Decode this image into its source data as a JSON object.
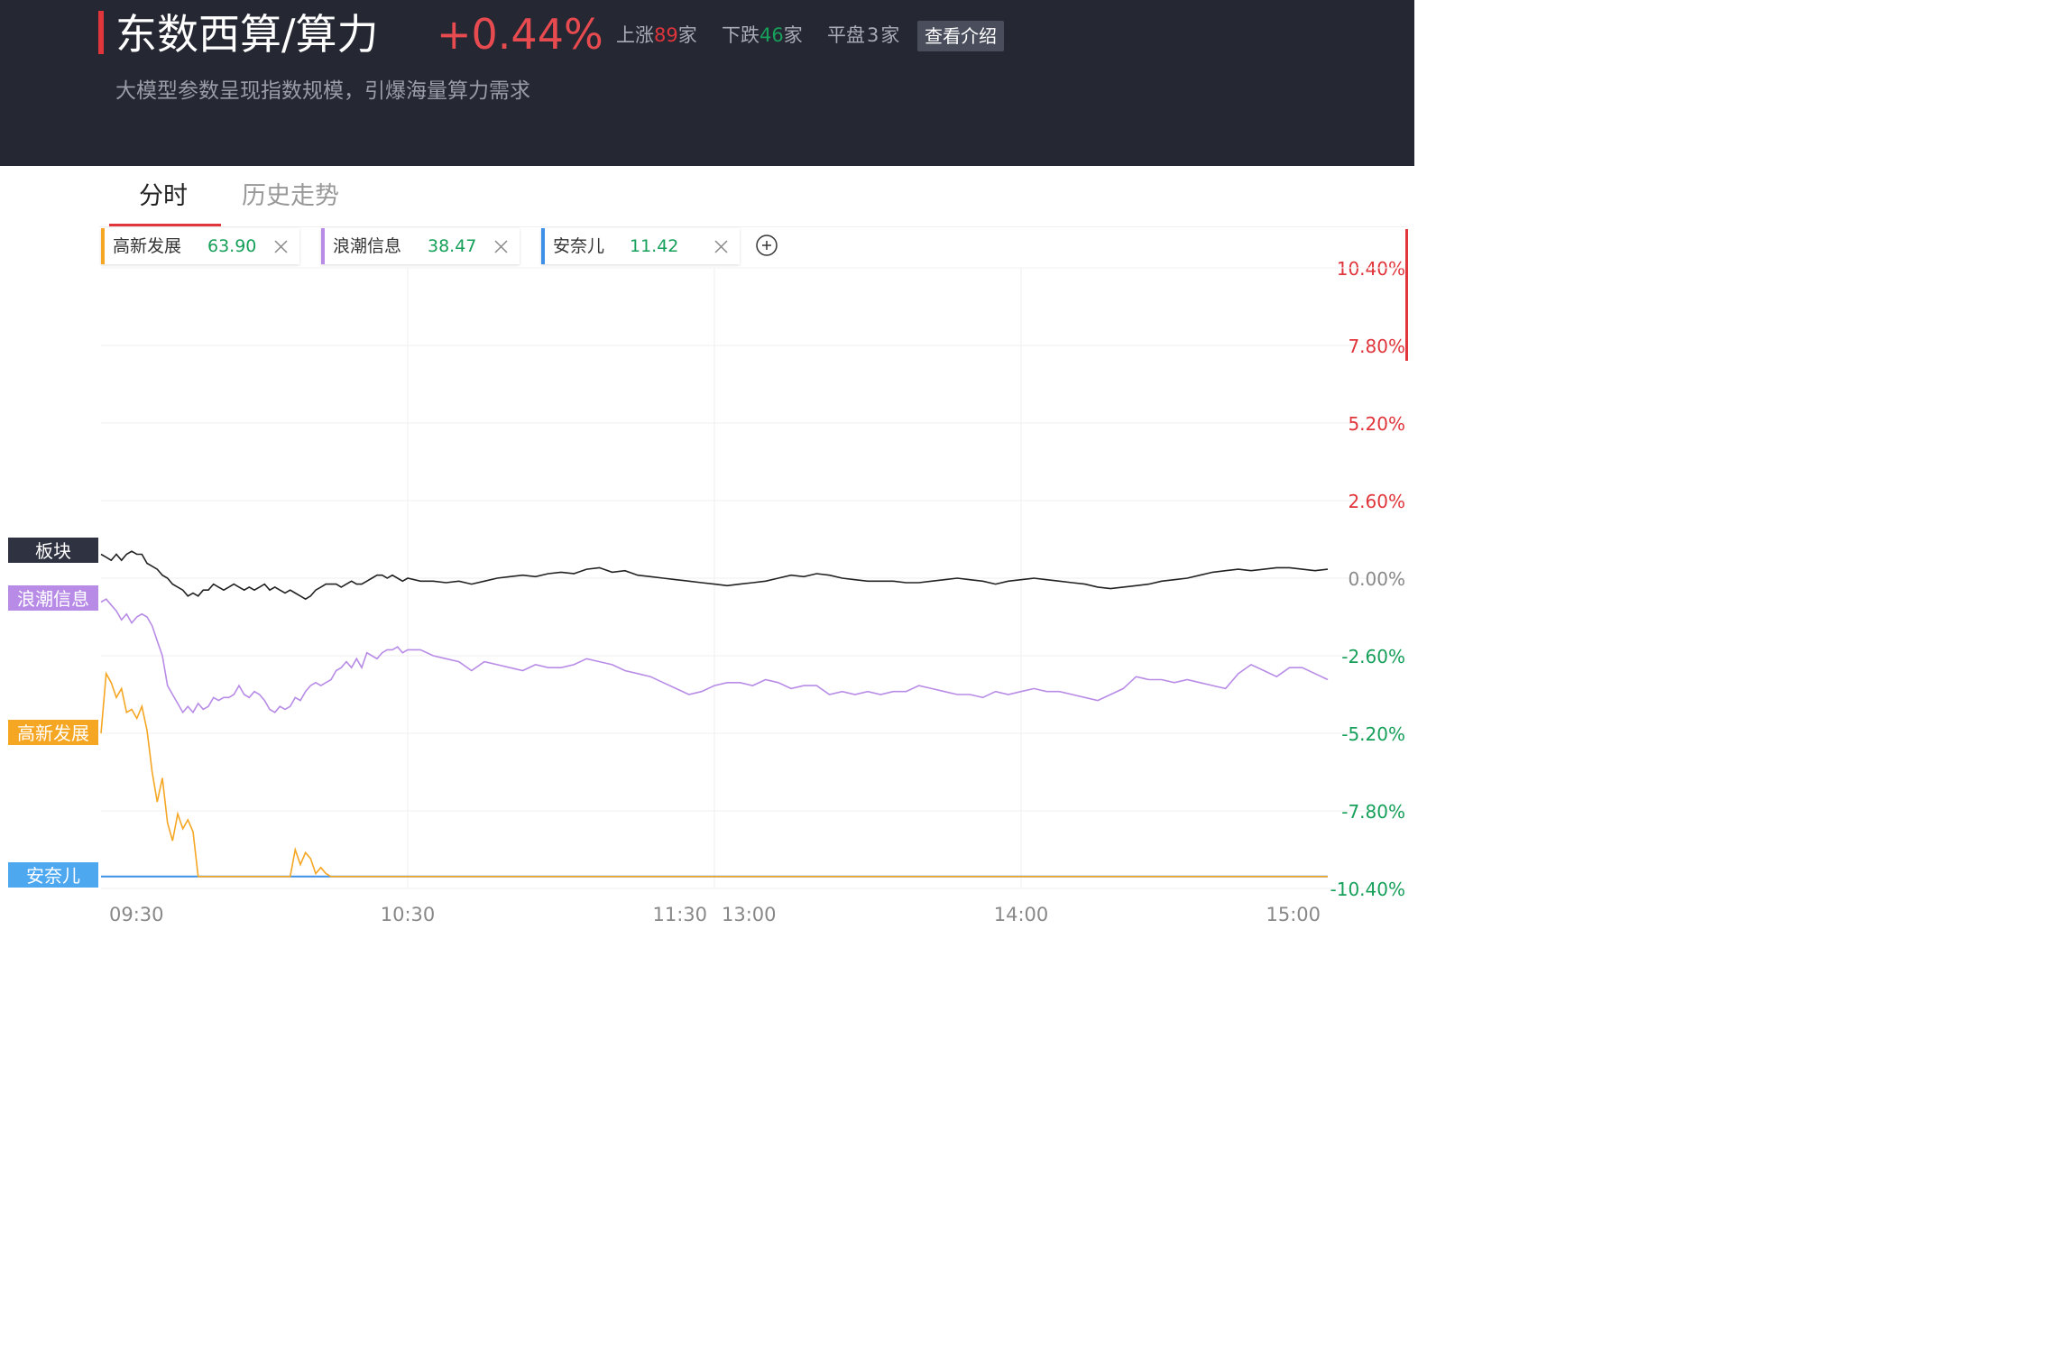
{
  "header": {
    "title": "东数西算/算力",
    "change": "+0.44%",
    "up_label": "上涨",
    "up_count": "89",
    "down_label": "下跌",
    "down_count": "46",
    "flat_label": "平盘",
    "flat_count": "3",
    "unit": "家",
    "intro_button": "查看介绍",
    "subtitle": "大模型参数呈现指数规模，引爆海量算力需求"
  },
  "tabs": [
    {
      "label": "分时",
      "active": true
    },
    {
      "label": "历史走势",
      "active": false
    }
  ],
  "compare_stocks": [
    {
      "name": "高新发展",
      "price": "63.90",
      "color": "#f5a623"
    },
    {
      "name": "浪潮信息",
      "price": "38.47",
      "color": "#b88ce6"
    },
    {
      "name": "安奈儿",
      "price": "11.42",
      "color": "#3d8fe8"
    }
  ],
  "icons": {
    "close": "close-icon",
    "add": "plus-circle-icon"
  },
  "chart_data": {
    "type": "line",
    "x_ticks": [
      "09:30",
      "10:30",
      "11:30",
      "13:00",
      "14:00",
      "15:00"
    ],
    "y_ticks": [
      "10.40%",
      "7.80%",
      "5.20%",
      "2.60%",
      "0.00%",
      "-2.60%",
      "-5.20%",
      "-7.80%",
      "-10.40%"
    ],
    "y_range": [
      -10.4,
      10.4
    ],
    "x_range": [
      0,
      240
    ],
    "grid": true,
    "colors": {
      "up": "#e0353b",
      "down": "#16a05a",
      "flat": "#888888"
    },
    "series": [
      {
        "name": "板块",
        "label_bg": "#2f3240",
        "color": "#222222",
        "points": [
          [
            0,
            0.8
          ],
          [
            2,
            0.7
          ],
          [
            4,
            0.6
          ],
          [
            6,
            0.8
          ],
          [
            8,
            0.6
          ],
          [
            10,
            0.8
          ],
          [
            12,
            0.9
          ],
          [
            14,
            0.8
          ],
          [
            16,
            0.8
          ],
          [
            18,
            0.5
          ],
          [
            20,
            0.4
          ],
          [
            22,
            0.3
          ],
          [
            24,
            0.1
          ],
          [
            26,
            0.0
          ],
          [
            28,
            -0.2
          ],
          [
            30,
            -0.3
          ],
          [
            32,
            -0.4
          ],
          [
            34,
            -0.6
          ],
          [
            36,
            -0.5
          ],
          [
            38,
            -0.6
          ],
          [
            40,
            -0.4
          ],
          [
            42,
            -0.4
          ],
          [
            44,
            -0.2
          ],
          [
            46,
            -0.3
          ],
          [
            48,
            -0.4
          ],
          [
            50,
            -0.3
          ],
          [
            52,
            -0.2
          ],
          [
            54,
            -0.3
          ],
          [
            56,
            -0.4
          ],
          [
            58,
            -0.3
          ],
          [
            60,
            -0.4
          ],
          [
            62,
            -0.3
          ],
          [
            64,
            -0.2
          ],
          [
            66,
            -0.4
          ],
          [
            68,
            -0.3
          ],
          [
            70,
            -0.4
          ],
          [
            72,
            -0.5
          ],
          [
            74,
            -0.4
          ],
          [
            76,
            -0.5
          ],
          [
            78,
            -0.6
          ],
          [
            80,
            -0.7
          ],
          [
            82,
            -0.6
          ],
          [
            84,
            -0.4
          ],
          [
            86,
            -0.3
          ],
          [
            88,
            -0.2
          ],
          [
            90,
            -0.2
          ],
          [
            92,
            -0.2
          ],
          [
            94,
            -0.3
          ],
          [
            96,
            -0.2
          ],
          [
            98,
            -0.1
          ],
          [
            100,
            -0.2
          ],
          [
            102,
            -0.2
          ],
          [
            104,
            -0.1
          ],
          [
            106,
            0.0
          ],
          [
            108,
            0.1
          ],
          [
            110,
            0.1
          ],
          [
            112,
            0.0
          ],
          [
            114,
            0.1
          ],
          [
            116,
            0.0
          ],
          [
            118,
            -0.1
          ],
          [
            120,
            0.0
          ],
          [
            125,
            -0.1
          ],
          [
            130,
            -0.1
          ],
          [
            135,
            -0.15
          ],
          [
            140,
            -0.1
          ],
          [
            145,
            -0.2
          ],
          [
            150,
            -0.1
          ],
          [
            155,
            0.0
          ],
          [
            160,
            0.05
          ],
          [
            165,
            0.1
          ],
          [
            170,
            0.05
          ],
          [
            175,
            0.15
          ],
          [
            180,
            0.2
          ],
          [
            185,
            0.15
          ],
          [
            190,
            0.3
          ],
          [
            195,
            0.35
          ],
          [
            200,
            0.2
          ],
          [
            205,
            0.25
          ],
          [
            210,
            0.1
          ],
          [
            215,
            0.05
          ],
          [
            220,
            0.0
          ],
          [
            225,
            -0.05
          ],
          [
            230,
            -0.1
          ],
          [
            235,
            -0.15
          ],
          [
            240,
            -0.2
          ],
          [
            245,
            -0.25
          ],
          [
            250,
            -0.2
          ],
          [
            255,
            -0.15
          ],
          [
            260,
            -0.1
          ],
          [
            265,
            0.0
          ],
          [
            270,
            0.1
          ],
          [
            275,
            0.05
          ],
          [
            280,
            0.15
          ],
          [
            285,
            0.1
          ],
          [
            290,
            0.0
          ],
          [
            295,
            -0.05
          ],
          [
            300,
            -0.1
          ],
          [
            305,
            -0.1
          ],
          [
            310,
            -0.1
          ],
          [
            315,
            -0.15
          ],
          [
            320,
            -0.15
          ],
          [
            325,
            -0.1
          ],
          [
            330,
            -0.05
          ],
          [
            335,
            0.0
          ],
          [
            340,
            -0.05
          ],
          [
            345,
            -0.1
          ],
          [
            350,
            -0.2
          ],
          [
            355,
            -0.1
          ],
          [
            360,
            -0.05
          ],
          [
            365,
            0.0
          ],
          [
            370,
            -0.05
          ],
          [
            375,
            -0.1
          ],
          [
            380,
            -0.15
          ],
          [
            385,
            -0.2
          ],
          [
            390,
            -0.3
          ],
          [
            395,
            -0.35
          ],
          [
            400,
            -0.3
          ],
          [
            405,
            -0.25
          ],
          [
            410,
            -0.2
          ],
          [
            415,
            -0.1
          ],
          [
            420,
            -0.05
          ],
          [
            425,
            0.0
          ],
          [
            430,
            0.1
          ],
          [
            435,
            0.2
          ],
          [
            440,
            0.25
          ],
          [
            445,
            0.3
          ],
          [
            450,
            0.25
          ],
          [
            455,
            0.3
          ],
          [
            460,
            0.35
          ],
          [
            465,
            0.35
          ],
          [
            470,
            0.3
          ],
          [
            475,
            0.25
          ],
          [
            480,
            0.3
          ]
        ]
      },
      {
        "name": "浪潮信息",
        "label_bg": "#b88ce6",
        "color": "#b88ce6",
        "points": [
          [
            0,
            -0.8
          ],
          [
            2,
            -0.7
          ],
          [
            4,
            -0.9
          ],
          [
            6,
            -1.1
          ],
          [
            8,
            -1.4
          ],
          [
            10,
            -1.2
          ],
          [
            12,
            -1.5
          ],
          [
            14,
            -1.3
          ],
          [
            16,
            -1.2
          ],
          [
            18,
            -1.3
          ],
          [
            20,
            -1.6
          ],
          [
            22,
            -2.1
          ],
          [
            24,
            -2.6
          ],
          [
            26,
            -3.6
          ],
          [
            28,
            -3.9
          ],
          [
            30,
            -4.2
          ],
          [
            32,
            -4.5
          ],
          [
            34,
            -4.3
          ],
          [
            36,
            -4.5
          ],
          [
            38,
            -4.2
          ],
          [
            40,
            -4.4
          ],
          [
            42,
            -4.3
          ],
          [
            44,
            -4.0
          ],
          [
            46,
            -4.1
          ],
          [
            48,
            -4.0
          ],
          [
            50,
            -4.0
          ],
          [
            52,
            -3.9
          ],
          [
            54,
            -3.6
          ],
          [
            56,
            -3.9
          ],
          [
            58,
            -4.0
          ],
          [
            60,
            -3.8
          ],
          [
            62,
            -3.9
          ],
          [
            64,
            -4.1
          ],
          [
            66,
            -4.4
          ],
          [
            68,
            -4.5
          ],
          [
            70,
            -4.3
          ],
          [
            72,
            -4.4
          ],
          [
            74,
            -4.3
          ],
          [
            76,
            -4.0
          ],
          [
            78,
            -4.1
          ],
          [
            80,
            -3.8
          ],
          [
            82,
            -3.6
          ],
          [
            84,
            -3.5
          ],
          [
            86,
            -3.6
          ],
          [
            88,
            -3.5
          ],
          [
            90,
            -3.4
          ],
          [
            92,
            -3.1
          ],
          [
            94,
            -3.0
          ],
          [
            96,
            -2.8
          ],
          [
            98,
            -3.0
          ],
          [
            100,
            -2.7
          ],
          [
            102,
            -3.0
          ],
          [
            104,
            -2.5
          ],
          [
            106,
            -2.6
          ],
          [
            108,
            -2.7
          ],
          [
            110,
            -2.5
          ],
          [
            112,
            -2.4
          ],
          [
            114,
            -2.4
          ],
          [
            116,
            -2.3
          ],
          [
            118,
            -2.5
          ],
          [
            120,
            -2.4
          ],
          [
            125,
            -2.4
          ],
          [
            130,
            -2.6
          ],
          [
            135,
            -2.7
          ],
          [
            140,
            -2.8
          ],
          [
            145,
            -3.1
          ],
          [
            150,
            -2.8
          ],
          [
            155,
            -2.9
          ],
          [
            160,
            -3.0
          ],
          [
            165,
            -3.1
          ],
          [
            170,
            -2.9
          ],
          [
            175,
            -3.0
          ],
          [
            180,
            -3.0
          ],
          [
            185,
            -2.9
          ],
          [
            190,
            -2.7
          ],
          [
            195,
            -2.8
          ],
          [
            200,
            -2.9
          ],
          [
            205,
            -3.1
          ],
          [
            210,
            -3.2
          ],
          [
            215,
            -3.3
          ],
          [
            220,
            -3.5
          ],
          [
            225,
            -3.7
          ],
          [
            230,
            -3.9
          ],
          [
            235,
            -3.8
          ],
          [
            240,
            -3.6
          ],
          [
            245,
            -3.5
          ],
          [
            250,
            -3.5
          ],
          [
            255,
            -3.6
          ],
          [
            260,
            -3.4
          ],
          [
            265,
            -3.5
          ],
          [
            270,
            -3.7
          ],
          [
            275,
            -3.6
          ],
          [
            280,
            -3.6
          ],
          [
            285,
            -3.9
          ],
          [
            290,
            -3.8
          ],
          [
            295,
            -3.9
          ],
          [
            300,
            -3.8
          ],
          [
            305,
            -3.9
          ],
          [
            310,
            -3.8
          ],
          [
            315,
            -3.8
          ],
          [
            320,
            -3.6
          ],
          [
            325,
            -3.7
          ],
          [
            330,
            -3.8
          ],
          [
            335,
            -3.9
          ],
          [
            340,
            -3.9
          ],
          [
            345,
            -4.0
          ],
          [
            350,
            -3.8
          ],
          [
            355,
            -3.9
          ],
          [
            360,
            -3.8
          ],
          [
            365,
            -3.7
          ],
          [
            370,
            -3.8
          ],
          [
            375,
            -3.8
          ],
          [
            380,
            -3.9
          ],
          [
            385,
            -4.0
          ],
          [
            390,
            -4.1
          ],
          [
            395,
            -3.9
          ],
          [
            400,
            -3.7
          ],
          [
            405,
            -3.3
          ],
          [
            410,
            -3.4
          ],
          [
            415,
            -3.4
          ],
          [
            420,
            -3.5
          ],
          [
            425,
            -3.4
          ],
          [
            430,
            -3.5
          ],
          [
            435,
            -3.6
          ],
          [
            440,
            -3.7
          ],
          [
            445,
            -3.2
          ],
          [
            450,
            -2.9
          ],
          [
            455,
            -3.1
          ],
          [
            460,
            -3.3
          ],
          [
            465,
            -3.0
          ],
          [
            470,
            -3.0
          ],
          [
            475,
            -3.2
          ],
          [
            480,
            -3.4
          ]
        ]
      },
      {
        "name": "高新发展",
        "label_bg": "#f5a623",
        "color": "#f5a623",
        "points": [
          [
            0,
            -5.2
          ],
          [
            2,
            -3.2
          ],
          [
            4,
            -3.5
          ],
          [
            6,
            -4.0
          ],
          [
            8,
            -3.7
          ],
          [
            10,
            -4.5
          ],
          [
            12,
            -4.4
          ],
          [
            14,
            -4.7
          ],
          [
            16,
            -4.3
          ],
          [
            18,
            -5.1
          ],
          [
            20,
            -6.5
          ],
          [
            22,
            -7.5
          ],
          [
            24,
            -6.7
          ],
          [
            26,
            -8.2
          ],
          [
            28,
            -8.8
          ],
          [
            30,
            -7.9
          ],
          [
            32,
            -8.4
          ],
          [
            34,
            -8.1
          ],
          [
            36,
            -8.5
          ],
          [
            38,
            -10.0
          ],
          [
            40,
            -10.0
          ],
          [
            42,
            -10.0
          ],
          [
            50,
            -10.0
          ],
          [
            60,
            -10.0
          ],
          [
            70,
            -10.0
          ],
          [
            74,
            -10.0
          ],
          [
            76,
            -9.1
          ],
          [
            78,
            -9.6
          ],
          [
            80,
            -9.2
          ],
          [
            82,
            -9.4
          ],
          [
            84,
            -9.9
          ],
          [
            86,
            -9.7
          ],
          [
            88,
            -9.9
          ],
          [
            90,
            -10.0
          ],
          [
            100,
            -10.0
          ],
          [
            110,
            -10.0
          ],
          [
            480,
            -10.0
          ]
        ]
      },
      {
        "name": "安奈儿",
        "label_bg": "#4ea8f0",
        "color": "#3d8fe8",
        "points": [
          [
            0,
            -10.0
          ],
          [
            480,
            -10.0
          ]
        ]
      }
    ]
  }
}
